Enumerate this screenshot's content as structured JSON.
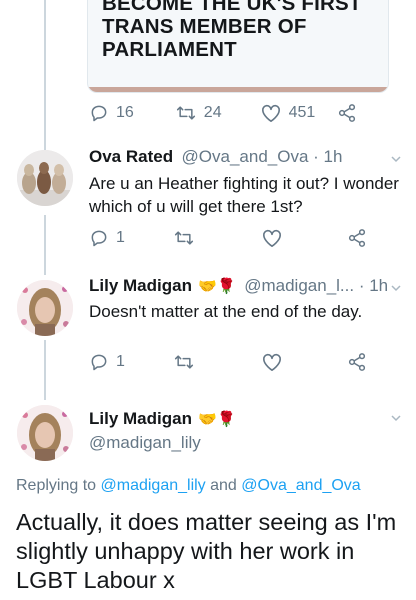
{
  "quoted_card": {
    "title": "BECOME THE UK'S FIRST TRANS MEMBER OF PARLIAMENT"
  },
  "tweet0_actions": {
    "replies": "16",
    "retweets": "24",
    "likes": "451"
  },
  "tweet1": {
    "name": "Ova Rated",
    "handle": "@Ova_and_Ova · 1h",
    "text": "Are u an Heather fighting it out? I wonder which of u will get there 1st?",
    "replies": "1"
  },
  "tweet2": {
    "name": "Lily Madigan",
    "emoji": "🤝🌹",
    "handle": "@madigan_l... · 1h",
    "text": "Doesn't matter at the end of the day.",
    "replies": "1"
  },
  "tweet3": {
    "name": "Lily Madigan",
    "emoji": "🤝🌹",
    "handle": "@madigan_lily",
    "replying_prefix": "Replying to ",
    "replying_user1": "@madigan_lily",
    "replying_and": " and ",
    "replying_user2": "@Ova_and_Ova",
    "text": "Actually, it does matter seeing as I'm slightly unhappy with her work in LGBT Labour x"
  },
  "colors": {
    "accent": "#1da1f2",
    "muted": "#657786",
    "line": "#ccd6dd"
  },
  "icons": [
    "reply-icon",
    "retweet-icon",
    "like-icon",
    "share-icon",
    "chevron-down-icon",
    "handshake-emoji",
    "rose-emoji"
  ]
}
